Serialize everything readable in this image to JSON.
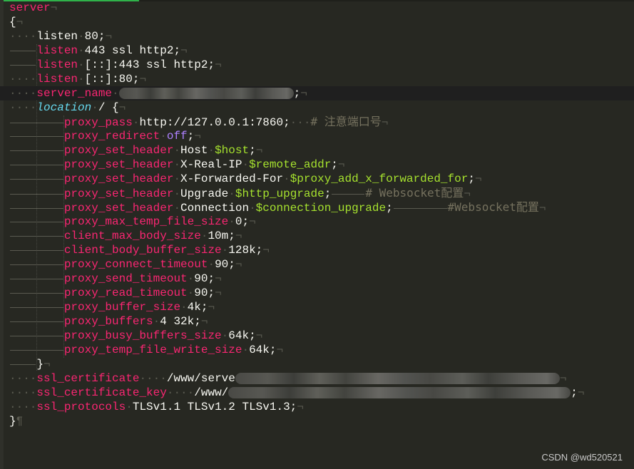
{
  "editor": {
    "theme_colors": {
      "background": "#272822",
      "keyword": "#f92672",
      "location_keyword": "#66d9ef",
      "variable": "#a6e22e",
      "constant": "#ae81ff",
      "comment": "#75715e",
      "text": "#f8f8f2",
      "tab_accent": "#2fb34a"
    },
    "lines": {
      "l01": {
        "kw": "server"
      },
      "l02": {
        "text": "{"
      },
      "l03": {
        "kw": "listen",
        "value": "80;"
      },
      "l04": {
        "kw": "listen",
        "value": "443 ssl http2;"
      },
      "l05": {
        "kw": "listen",
        "value": "[::]:443 ssl http2;"
      },
      "l06": {
        "kw": "listen",
        "value": "[::]:80;"
      },
      "l07": {
        "kw": "server_name",
        "value_redacted": true,
        "tail": ";"
      },
      "l08": {
        "kw": "location",
        "value": "/ {"
      },
      "l09": {
        "kw": "proxy_pass",
        "value": "http://127.0.0.1:7860;",
        "comment": "# 注意端口号"
      },
      "l10": {
        "kw": "proxy_redirect",
        "value": "off",
        "tail": ";"
      },
      "l11": {
        "kw": "proxy_set_header",
        "header": "Host",
        "var": "$host",
        "tail": ";"
      },
      "l12": {
        "kw": "proxy_set_header",
        "header": "X-Real-IP",
        "var": "$remote_addr",
        "tail": ";"
      },
      "l13": {
        "kw": "proxy_set_header",
        "header": "X-Forwarded-For",
        "var": "$proxy_add_x_forwarded_for",
        "tail": ";"
      },
      "l14": {
        "kw": "proxy_set_header",
        "header": "Upgrade",
        "var": "$http_upgrade",
        "tail": ";",
        "comment": "# Websocket配置"
      },
      "l15": {
        "kw": "proxy_set_header",
        "header": "Connection",
        "var": "$connection_upgrade",
        "tail": ";",
        "comment": "#Websocket配置"
      },
      "l16": {
        "kw": "proxy_max_temp_file_size",
        "value": "0;"
      },
      "l17": {
        "kw": "client_max_body_size",
        "value": "10m;"
      },
      "l18": {
        "kw": "client_body_buffer_size",
        "value": "128k;"
      },
      "l19": {
        "kw": "proxy_connect_timeout",
        "value": "90;"
      },
      "l20": {
        "kw": "proxy_send_timeout",
        "value": "90;"
      },
      "l21": {
        "kw": "proxy_read_timeout",
        "value": "90;"
      },
      "l22": {
        "kw": "proxy_buffer_size",
        "value": "4k;"
      },
      "l23": {
        "kw": "proxy_buffers",
        "value": "4 32k;"
      },
      "l24": {
        "kw": "proxy_busy_buffers_size",
        "value": "64k;"
      },
      "l25": {
        "kw": "proxy_temp_file_write_size",
        "value": "64k;"
      },
      "l26": {
        "text": "}"
      },
      "l27": {
        "kw": "ssl_certificate",
        "value": "/www/serve",
        "value_redacted": true
      },
      "l28": {
        "kw": "ssl_certificate_key",
        "value": "/www/",
        "value_redacted": true,
        "tail": ";"
      },
      "l29": {
        "kw": "ssl_protocols",
        "value": "TLSv1.1 TLSv1.2 TLSv1.3;"
      },
      "l30": {
        "text": "}"
      }
    }
  },
  "watermark": "CSDN @wd520521"
}
